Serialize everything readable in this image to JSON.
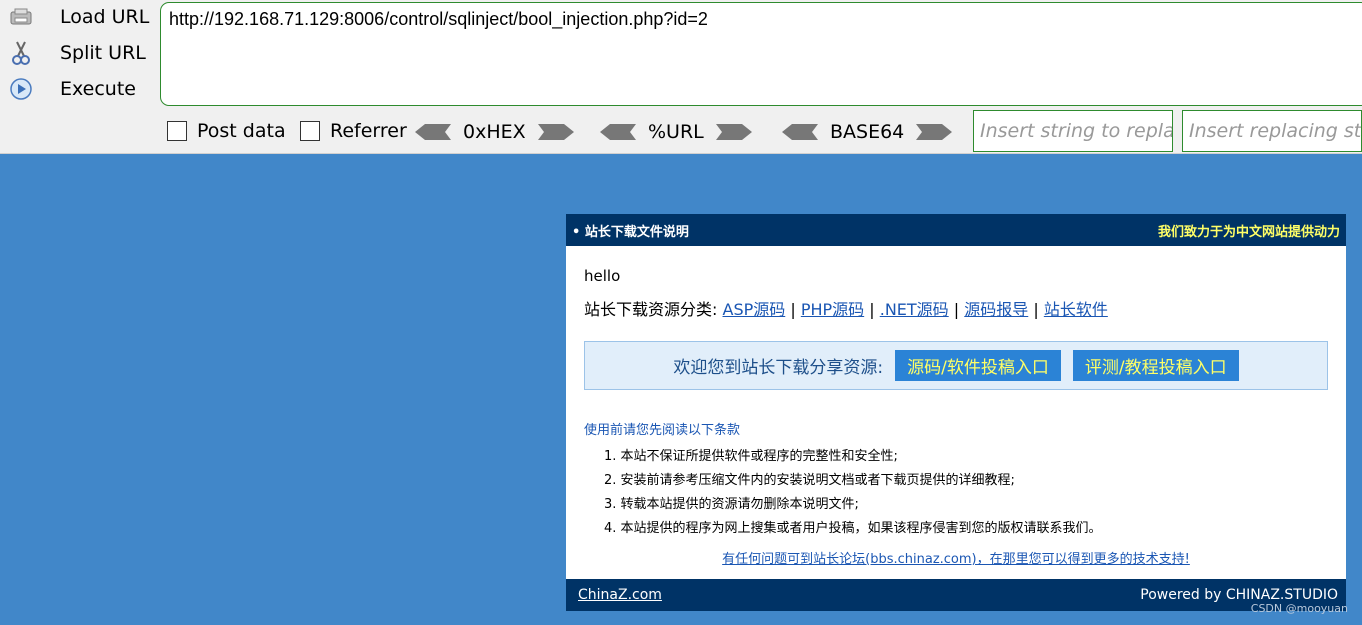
{
  "toolbar": {
    "load_url": "Load URL",
    "split_url": "Split URL",
    "execute": "Execute",
    "url_value": "http://192.168.71.129:8006/control/sqlinject/bool_injection.php?id=2",
    "post_data": "Post data",
    "referrer": "Referrer",
    "hex": "0xHEX",
    "url_enc": "%URL",
    "base64": "BASE64",
    "replace_placeholder": "Insert string to replace",
    "replacing_placeholder": "Insert replacing string"
  },
  "panel": {
    "header_left": "• 站长下载文件说明",
    "header_right": "我们致力于为中文网站提供动力",
    "hello": "hello",
    "cat_label": "站长下载资源分类:",
    "cats": [
      "ASP源码",
      "PHP源码",
      ".NET源码",
      "源码报导",
      "站长软件"
    ],
    "welcome_text": "欢迎您到站长下载分享资源:",
    "btn_source": "源码/软件投稿入口",
    "btn_review": "评测/教程投稿入口",
    "terms_title": "使用前请您先阅读以下条款",
    "terms": [
      "1. 本站不保证所提供软件或程序的完整性和安全性;",
      "2. 安装前请参考压缩文件内的安装说明文档或者下载页提供的详细教程;",
      "3. 转载本站提供的资源请勿删除本说明文件;",
      "4. 本站提供的程序为网上搜集或者用户投稿，如果该程序侵害到您的版权请联系我们。"
    ],
    "forum_link": "有任何问题可到站长论坛(bbs.chinaz.com)，在那里您可以得到更多的技术支持!",
    "footer_left": "ChinaZ.com",
    "footer_right": "Powered by CHINAZ.STUDIO"
  },
  "watermark": "CSDN @mooyuan"
}
